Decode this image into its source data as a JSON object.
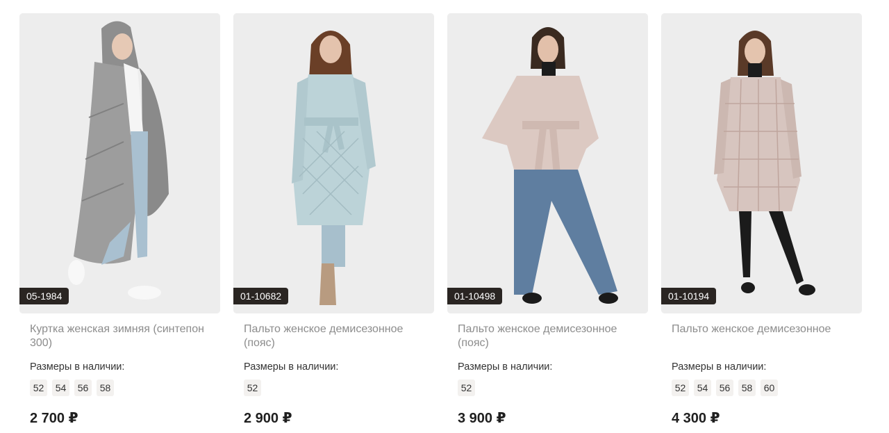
{
  "products": [
    {
      "sku": "05-1984",
      "title": "Куртка женская зимняя (синтепон 300)",
      "sizes_label": "Размеры в наличии:",
      "sizes": [
        "52",
        "54",
        "56",
        "58"
      ],
      "price": "2 700 ₽",
      "coat_color": "#9a9a9a"
    },
    {
      "sku": "01-10682",
      "title": "Пальто женское демисезонное (пояс)",
      "sizes_label": "Размеры в наличии:",
      "sizes": [
        "52"
      ],
      "price": "2 900 ₽",
      "coat_color": "#bcd3d8"
    },
    {
      "sku": "01-10498",
      "title": "Пальто женское демисезонное (пояс)",
      "sizes_label": "Размеры в наличии:",
      "sizes": [
        "52"
      ],
      "price": "3 900 ₽",
      "coat_color": "#dcc9c2"
    },
    {
      "sku": "01-10194",
      "title": "Пальто женское демисезонное",
      "sizes_label": "Размеры в наличии:",
      "sizes": [
        "52",
        "54",
        "56",
        "58",
        "60"
      ],
      "price": "4 300 ₽",
      "coat_color": "#d7c5bf"
    }
  ]
}
